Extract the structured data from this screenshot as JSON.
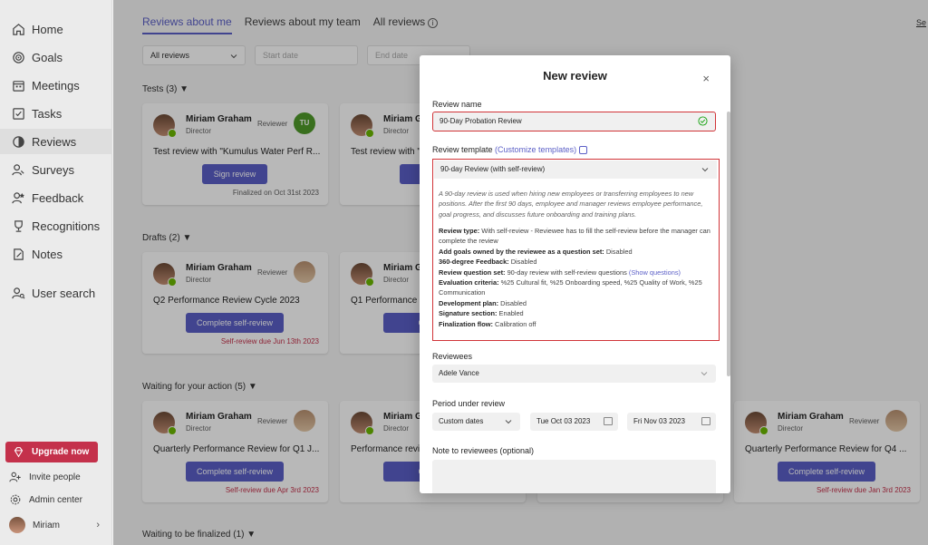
{
  "sidebar": {
    "items": [
      {
        "label": "Home",
        "icon": "home-icon"
      },
      {
        "label": "Goals",
        "icon": "target-icon"
      },
      {
        "label": "Meetings",
        "icon": "calendar-icon"
      },
      {
        "label": "Tasks",
        "icon": "checkbox-icon"
      },
      {
        "label": "Reviews",
        "icon": "reviews-icon"
      },
      {
        "label": "Surveys",
        "icon": "surveys-icon"
      },
      {
        "label": "Feedback",
        "icon": "feedback-icon"
      },
      {
        "label": "Recognitions",
        "icon": "trophy-icon"
      },
      {
        "label": "Notes",
        "icon": "notes-icon"
      },
      {
        "label": "User search",
        "icon": "user-search-icon"
      }
    ],
    "active": "Reviews",
    "upgrade_label": "Upgrade now",
    "invite_label": "Invite people",
    "admin_label": "Admin center",
    "user_label": "Miriam"
  },
  "main": {
    "tabs": [
      "Reviews about me",
      "Reviews about my team",
      "All reviews"
    ],
    "top_link": "Se",
    "filter_all": "All reviews",
    "filter_start": "Start date",
    "filter_end": "End date",
    "sections": {
      "tests": "Tests (3)",
      "drafts": "Drafts (2)",
      "waiting_action": "Waiting for your action (5)",
      "waiting_final": "Waiting to be finalized (1)"
    },
    "cards": {
      "test1": {
        "name": "Miriam Graham",
        "role": "Director",
        "reviewer": "Reviewer",
        "reviewer_initials": "TU",
        "title": "Test review with \"Kumulus Water Perf R...",
        "button": "Sign review",
        "footer": "Finalized on Oct 31st 2023"
      },
      "test2": {
        "name": "Miriam G",
        "role": "Director",
        "title": "Test review with \"",
        "button": "Si"
      },
      "draft1": {
        "name": "Miriam Graham",
        "role": "Director",
        "reviewer": "Reviewer",
        "title": "Q2 Performance Review Cycle 2023",
        "button": "Complete self-review",
        "footer": "Self-review due Jun 13th 2023"
      },
      "draft2": {
        "name": "Miriam G",
        "role": "Director",
        "title": "Q1 Performance Re",
        "button": "Comple"
      },
      "wait1": {
        "name": "Miriam Graham",
        "role": "Director",
        "reviewer": "Reviewer",
        "title": "Quarterly Performance Review for Q1 J...",
        "button": "Complete self-review",
        "footer": "Self-review due Apr 3rd 2023"
      },
      "wait2": {
        "name": "Miriam G",
        "role": "Director",
        "title": "Performance revie",
        "button": "Comple"
      },
      "wait3": {
        "name": "Miriam Graham",
        "role": "Director",
        "reviewer": "Reviewer",
        "title": "Quarterly Performance Review for Q4 ...",
        "button": "Complete self-review",
        "footer": "Self-review due Jan 3rd 2023"
      }
    }
  },
  "modal": {
    "title": "New review",
    "close": "×",
    "review_name_label": "Review name",
    "review_name_value": "90-Day Probation Review",
    "template_label": "Review template",
    "customize_link": "(Customize templates)",
    "template_value": "90-day Review (with self-review)",
    "template_description": "A 90-day review is used when hiring new employees or transferring employees to new positions. After the first 90 days, employee and manager reviews employee performance, goal progress, and discusses future onboarding and training plans.",
    "details": {
      "review_type_label": "Review type:",
      "review_type_value": " With self-review - Reviewee has to fill the self-review before the manager can complete the review",
      "add_goals_label": "Add goals owned by the reviewee as a question set:",
      "add_goals_value": " Disabled",
      "feedback_label": "360-degree Feedback:",
      "feedback_value": " Disabled",
      "question_set_label": "Review question set:",
      "question_set_value": " 90-day review with self-review questions ",
      "show_questions": "(Show questions)",
      "criteria_label": "Evaluation criteria:",
      "criteria_value": " %25 Cultural fit, %25 Onboarding speed, %25 Quality of Work, %25 Communication",
      "dev_plan_label": "Development plan:",
      "dev_plan_value": " Disabled",
      "signature_label": "Signature section:",
      "signature_value": " Enabled",
      "finalization_label": "Finalization flow:",
      "finalization_value": " Calibration off"
    },
    "reviewees_label": "Reviewees",
    "reviewees_value": "Adele Vance",
    "period_label": "Period under review",
    "period_type": "Custom dates",
    "period_start": "Tue Oct 03 2023",
    "period_end": "Fri Nov 03 2023",
    "note_label": "Note to reviewees (optional)"
  },
  "colors": {
    "accent": "#5b5fc7",
    "upgrade": "#c4314b",
    "highlight_border": "#d13438",
    "presence": "#6bb700",
    "success": "#13a10e"
  }
}
